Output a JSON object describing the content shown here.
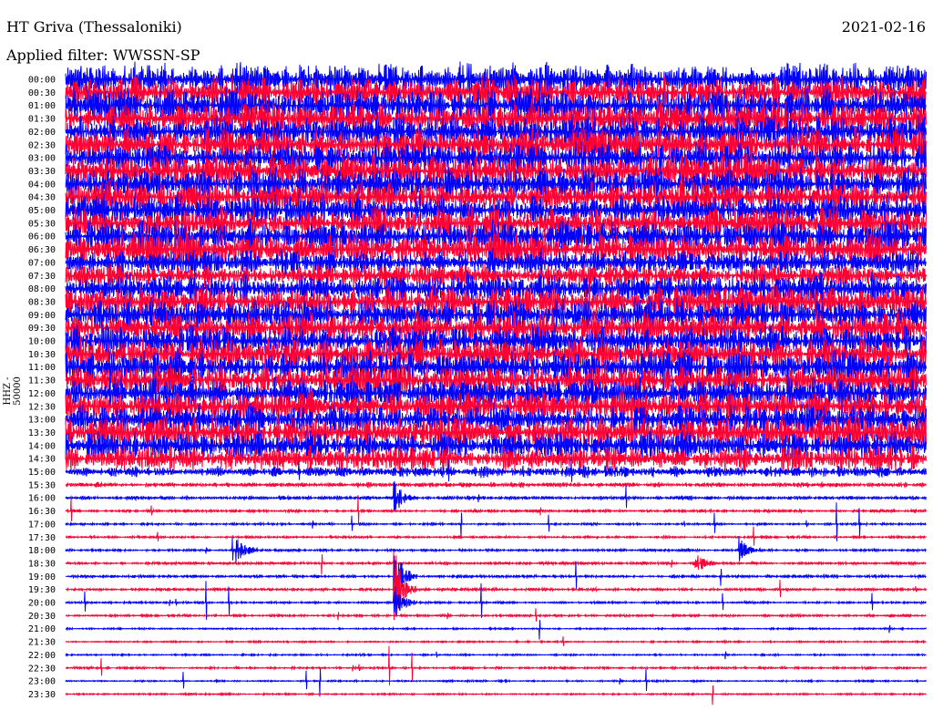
{
  "header": {
    "station": "HT Griva (Thessaloniki)",
    "date": "2021-02-16",
    "filter": "Applied filter: WWSSN-SP"
  },
  "chart_data": {
    "type": "line",
    "title": "HT Griva (Thessaloniki)",
    "ylabel": "HHZ - 50000",
    "xlabel": "",
    "colors": [
      "#0000ff",
      "#ff0033"
    ],
    "row_labels": [
      "00:00",
      "00:30",
      "01:00",
      "01:30",
      "02:00",
      "02:30",
      "03:00",
      "03:30",
      "04:00",
      "04:30",
      "05:00",
      "05:30",
      "06:00",
      "06:30",
      "07:00",
      "07:30",
      "08:00",
      "08:30",
      "09:00",
      "09:30",
      "10:00",
      "10:30",
      "11:00",
      "11:30",
      "12:00",
      "12:30",
      "13:00",
      "13:30",
      "14:00",
      "14:30",
      "15:00",
      "15:30",
      "16:00",
      "16:30",
      "17:00",
      "17:30",
      "18:00",
      "18:30",
      "19:00",
      "19:30",
      "20:00",
      "20:30",
      "21:00",
      "21:30",
      "22:00",
      "22:30",
      "23:00",
      "23:30"
    ],
    "relative_amplitude": [
      1.0,
      1.0,
      1.0,
      1.0,
      1.0,
      1.0,
      1.0,
      1.0,
      1.0,
      1.0,
      1.0,
      1.0,
      1.0,
      1.1,
      0.8,
      0.7,
      1.0,
      1.0,
      1.0,
      1.0,
      1.0,
      1.0,
      1.0,
      1.0,
      1.0,
      1.0,
      1.0,
      1.0,
      0.9,
      0.8,
      0.35,
      0.15,
      0.12,
      0.1,
      0.08,
      0.08,
      0.08,
      0.1,
      0.1,
      0.1,
      0.08,
      0.08,
      0.06,
      0.06,
      0.06,
      0.08,
      0.06,
      0.06
    ],
    "events": [
      {
        "row": 38,
        "minute": 11.5,
        "amplitude": 2.5
      },
      {
        "row": 39,
        "minute": 11.5,
        "amplitude": 3.0
      },
      {
        "row": 40,
        "minute": 11.5,
        "amplitude": 1.5
      },
      {
        "row": 32,
        "minute": 11.5,
        "amplitude": 1.2
      },
      {
        "row": 36,
        "minute": 6.0,
        "amplitude": 1.0
      },
      {
        "row": 36,
        "minute": 23.5,
        "amplitude": 1.0
      },
      {
        "row": 37,
        "minute": 22.0,
        "amplitude": 0.8
      }
    ]
  }
}
